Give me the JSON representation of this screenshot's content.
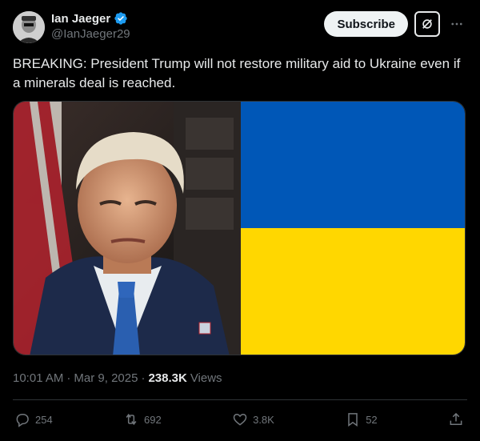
{
  "author": {
    "display_name": "Ian Jaeger",
    "handle": "@IanJaeger29"
  },
  "header": {
    "subscribe_label": "Subscribe",
    "more_icon": "more-horizontal-icon",
    "grok_icon": "grok-icon"
  },
  "post": {
    "text": "BREAKING: President Trump will not restore military aid to Ukraine even if a minerals deal is reached."
  },
  "media": {
    "left": "portrait photo",
    "right": "Ukrainian flag",
    "flag_colors": {
      "top": "#0057B7",
      "bottom": "#FFD700"
    }
  },
  "meta": {
    "time": "10:01 AM",
    "sep1": "·",
    "date": "Mar 9, 2025",
    "sep2": "·",
    "views_count": "238.3K",
    "views_label": "Views"
  },
  "actions": {
    "replies": "254",
    "reposts": "692",
    "likes": "3.8K",
    "bookmarks": "52"
  },
  "colors": {
    "background": "#000000",
    "text": "#e7e9ea",
    "secondary": "#71767b",
    "verified": "#1d9bf0",
    "border": "#2f3336"
  }
}
